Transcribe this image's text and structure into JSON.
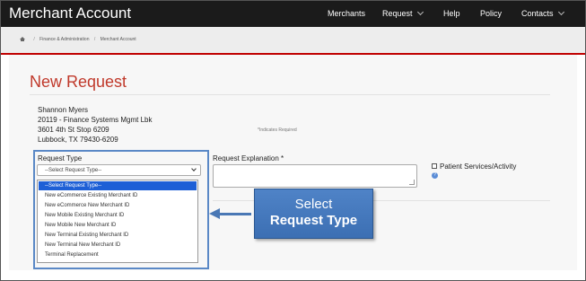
{
  "app": {
    "title": "Merchant Account"
  },
  "nav": {
    "merchants": "Merchants",
    "request": "Request",
    "help": "Help",
    "policy": "Policy",
    "contacts": "Contacts"
  },
  "breadcrumb": {
    "home_icon": "home-icon",
    "items": [
      "Finance & Administration",
      "Merchant Account"
    ]
  },
  "page": {
    "title": "New Request",
    "address": [
      "Shannon Myers",
      "20119 - Finance Systems Mgmt Lbk",
      "3601 4th St Stop 6209",
      "Lubbock, TX 79430-6209"
    ],
    "required_note": "*Indicates Required"
  },
  "form": {
    "request_type_label": "Request Type",
    "request_type_selected": "--Select Request Type--",
    "request_type_options": [
      "--Select Request Type--",
      "New eCommerce Existing Merchant ID",
      "New eCommerce New Merchant ID",
      "New Mobile Existing Merchant ID",
      "New Mobile New Merchant ID",
      "New Terminal Existing Merchant ID",
      "New Terminal New Merchant ID",
      "Terminal Replacement"
    ],
    "explanation_label": "Request Explanation *",
    "explanation_value": "",
    "patient_services_label": "Patient Services/Activity"
  },
  "callout": {
    "line1": "Select",
    "line2": "Request Type"
  },
  "colors": {
    "topbar": "#1b1b1b",
    "accent_red": "#c0392b",
    "selected_option": "#1e5fd6",
    "callout_blue": "#4a78b5"
  }
}
